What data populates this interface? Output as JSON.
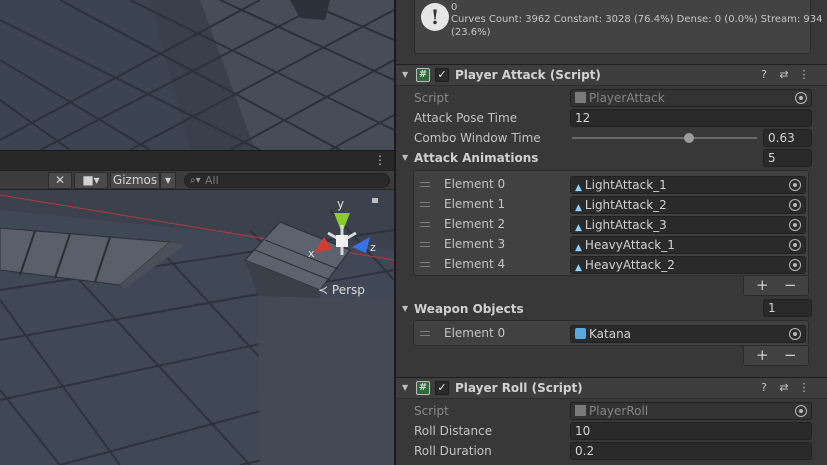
{
  "scene_view": {
    "gizmos_label": "Gizmos",
    "search_placeholder": "All",
    "persp_label": "Persp",
    "axis_labels": {
      "x": "x",
      "y": "y",
      "z": "z"
    }
  },
  "inspector": {
    "help_box": {
      "lines": [
        "Curves Count: 3962 Constant: 3028 (76.4%) Dense: 0 (0.0%) Stream: 934",
        "(23.6%)"
      ],
      "top_line_partial": "0"
    },
    "player_attack": {
      "title": "Player Attack (Script)",
      "script_label": "Script",
      "script_value": "PlayerAttack",
      "attack_pose_time_label": "Attack Pose Time",
      "attack_pose_time_value": "12",
      "combo_window_time_label": "Combo Window Time",
      "combo_window_time_value": "0.63",
      "combo_window_fraction": 0.63,
      "attack_animations_label": "Attack Animations",
      "attack_animations_count": "5",
      "attack_animations": [
        {
          "label": "Element 0",
          "value": "LightAttack_1"
        },
        {
          "label": "Element 1",
          "value": "LightAttack_2"
        },
        {
          "label": "Element 2",
          "value": "LightAttack_3"
        },
        {
          "label": "Element 3",
          "value": "HeavyAttack_1"
        },
        {
          "label": "Element 4",
          "value": "HeavyAttack_2"
        }
      ],
      "weapon_objects_label": "Weapon Objects",
      "weapon_objects_count": "1",
      "weapon_objects": [
        {
          "label": "Element 0",
          "value": "Katana"
        }
      ]
    },
    "player_roll": {
      "title": "Player Roll (Script)",
      "script_label": "Script",
      "script_value": "PlayerRoll",
      "roll_distance_label": "Roll Distance",
      "roll_distance_value": "10",
      "roll_duration_label": "Roll Duration",
      "roll_duration_value": "0.2"
    },
    "list_buttons": {
      "add": "+",
      "remove": "−"
    }
  },
  "colors": {
    "inspector_bg": "#383838",
    "field_bg": "#2a2a2a",
    "gizmo_x": "#d23c32",
    "gizmo_y": "#8ccc2a",
    "gizmo_z": "#3c6ee6",
    "cs_icon": "#2e6a3a"
  },
  "icons": {
    "help_box": "info-icon",
    "script_field": "script-file-icon",
    "animation_clip": "animation-clip-icon",
    "prefab": "prefab-icon",
    "picker": "object-picker-icon"
  }
}
